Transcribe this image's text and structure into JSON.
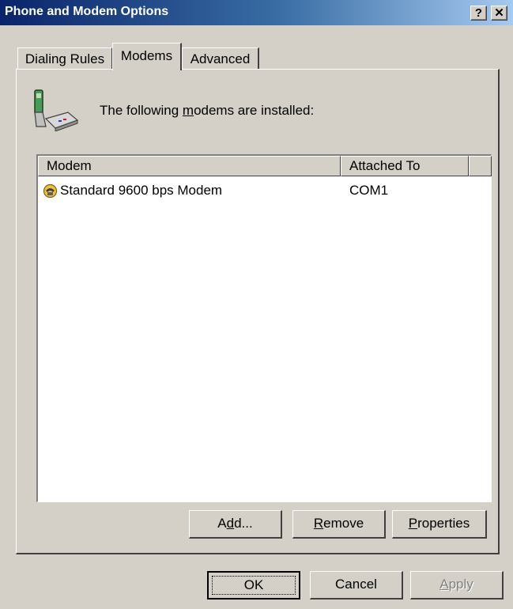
{
  "window": {
    "title": "Phone and Modem Options",
    "help_button": "?",
    "close_button": "✕"
  },
  "tabs": [
    {
      "label": "Dialing Rules",
      "active": false
    },
    {
      "label": "Modems",
      "active": true
    },
    {
      "label": "Advanced",
      "active": false
    }
  ],
  "modems_tab": {
    "header_icon": "phone-modem-icon",
    "intro_pre": "The following ",
    "intro_accel": "m",
    "intro_post": "odems are  installed:",
    "columns": [
      "Modem",
      "Attached To"
    ],
    "rows": [
      {
        "icon": "modem-icon",
        "modem": "Standard  9600 bps Modem",
        "attached_to": "COM1"
      }
    ],
    "add_button": {
      "pre": "A",
      "accel": "d",
      "post": "d..."
    },
    "remove_button": {
      "pre": "",
      "accel": "R",
      "post": "emove"
    },
    "properties_button": {
      "pre": "",
      "accel": "P",
      "post": "roperties"
    }
  },
  "footer": {
    "ok_label": "OK",
    "cancel_label": "Cancel",
    "apply_label": "Apply",
    "apply_accel": "A",
    "apply_post": "pply"
  }
}
